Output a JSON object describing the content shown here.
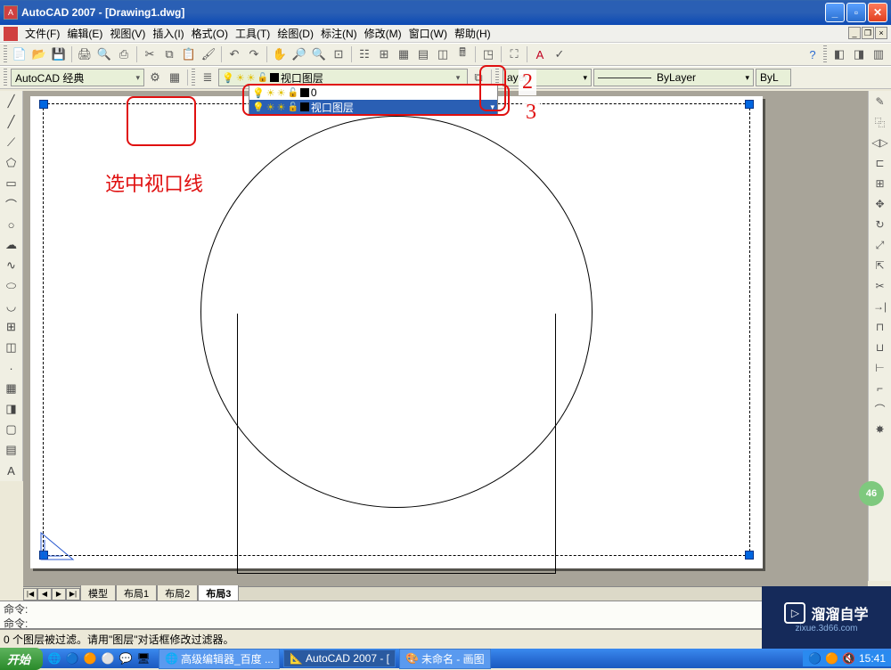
{
  "title": "AutoCAD 2007 - [Drawing1.dwg]",
  "menu": [
    "文件(F)",
    "编辑(E)",
    "视图(V)",
    "插入(I)",
    "格式(O)",
    "工具(T)",
    "绘图(D)",
    "标注(N)",
    "修改(M)",
    "窗口(W)",
    "帮助(H)"
  ],
  "workspace": "AutoCAD 经典",
  "layer_current": "视口图层",
  "layer_list": [
    {
      "name": "0",
      "selected": false
    },
    {
      "name": "视口图层",
      "selected": true
    }
  ],
  "linetype_combo": "ayer",
  "lineweight_combo": "ByLayer",
  "color_combo": "ByL",
  "annot": {
    "num2": "2",
    "num3": "3",
    "select_viewport": "选中视口线"
  },
  "tabs": {
    "model": "模型",
    "layout1": "布局1",
    "layout2": "布局2",
    "layout3": "布局3"
  },
  "cmd1": "命令:",
  "cmd2": "命令:",
  "status": "0 个图层被过滤。请用\"图层\"对话框修改过滤器。",
  "taskbar": {
    "start": "开始",
    "tasks": [
      {
        "label": "高级编辑器_百度 ...",
        "active": false
      },
      {
        "label": "AutoCAD 2007 - [",
        "active": true
      },
      {
        "label": "未命名 - 画图",
        "active": false
      }
    ],
    "time": "15:41"
  },
  "watermark": {
    "brand": "溜溜自学",
    "url": "zixue.3d66.com"
  },
  "badge": "46"
}
